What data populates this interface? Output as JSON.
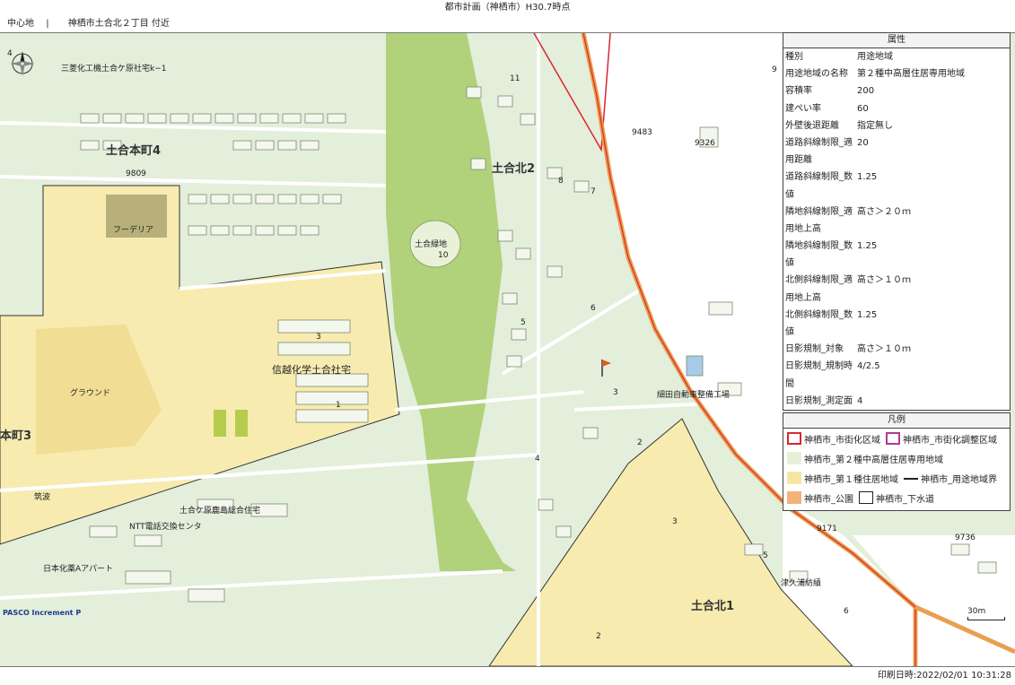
{
  "header": {
    "title": "都市計画（神栖市）H30.7時点",
    "location_label": "中心地",
    "location_value": "神栖市土合北２丁目 付近"
  },
  "map": {
    "labels": {
      "dogo_honmachi_4": "土合本町4",
      "dogo_kita_2": "土合北2",
      "dogo_kita_1": "土合北1",
      "honmachi_3": "本町3",
      "mitsubishi": "三菱化工機土合ケ原社宅k−1",
      "fuderia": "フーデリア",
      "ground": "グラウンド",
      "shinetsu": "信越化学土合社宅",
      "ryokuchi": "土合緑地",
      "ryokuchi_num": "10",
      "tsukuba": "筑波",
      "kashima": "土合ケ原鹿島総合住宅",
      "ntt": "NTT電話交換センタ",
      "nihonkayaku": "日本化薬Aアパート",
      "hosoda": "細田自動車整備工場",
      "tsukura": "津久浦紡績",
      "num_9809": "9809",
      "num_9326": "9326",
      "num_9483": "9483",
      "num_9171": "9171",
      "num_9736": "9736",
      "block_3a": "3",
      "block_1a": "1",
      "block_11": "11",
      "block_8": "8",
      "block_7": "7",
      "block_5": "5",
      "block_6": "6",
      "block_3b": "3",
      "block_4": "4",
      "block_2a": "2",
      "block_3c": "3",
      "block_2b": "2",
      "block_5b": "5",
      "block_6b": "6",
      "block_9a": "9",
      "block_4b": "4"
    },
    "pasco": "PASCO  Increment P",
    "scale": "30m"
  },
  "attributes": {
    "heading": "属性",
    "rows": [
      {
        "key": "種別",
        "value": "用途地域"
      },
      {
        "key": "用途地域の名称",
        "value": "第２種中高層住居専用地域"
      },
      {
        "key": "容積率",
        "value": "200"
      },
      {
        "key": "建ぺい率",
        "value": "60"
      },
      {
        "key": "外壁後退距離",
        "value": "指定無し"
      },
      {
        "key": "道路斜線制限_適",
        "value": "20"
      },
      {
        "key": "用距離",
        "value": ""
      },
      {
        "key": "道路斜線制限_数",
        "value": "1.25"
      },
      {
        "key": "値",
        "value": ""
      },
      {
        "key": "隣地斜線制限_適",
        "value": "高さ＞２０ｍ"
      },
      {
        "key": "用地上高",
        "value": ""
      },
      {
        "key": "隣地斜線制限_数",
        "value": "1.25"
      },
      {
        "key": "値",
        "value": ""
      },
      {
        "key": "北側斜線制限_適",
        "value": "高さ＞１０ｍ"
      },
      {
        "key": "用地上高",
        "value": ""
      },
      {
        "key": "北側斜線制限_数",
        "value": "1.25"
      },
      {
        "key": "値",
        "value": ""
      },
      {
        "key": "日影規制_対象",
        "value": "高さ＞１０ｍ"
      },
      {
        "key": "日影規制_規制時",
        "value": "4/2.5"
      },
      {
        "key": "間",
        "value": ""
      },
      {
        "key": "日影規制_測定面",
        "value": "4"
      }
    ]
  },
  "legend": {
    "heading": "凡例",
    "items": [
      {
        "label": "神栖市_市街化区域",
        "color": "#d9272e"
      },
      {
        "label": "神栖市_市街化調整区域",
        "color": "#b03a8c"
      },
      {
        "label": "神栖市_第２種中高層住居専用地域",
        "color": "#e6f0d8"
      },
      {
        "label": "神栖市_第１種住居地域",
        "color": "#f6e6a6"
      },
      {
        "label": "神栖市_用途地域界",
        "color": "#222222"
      },
      {
        "label": "神栖市_公園",
        "color": "#f2b27a"
      },
      {
        "label": "神栖市_下水道",
        "color": "#ffffff"
      }
    ]
  },
  "footer": {
    "print_date": "印刷日時:2022/02/01 10:31:28"
  },
  "colors": {
    "zone2_residential": "#e3eedb",
    "zone1_residential": "#f7ebb0",
    "park_green": "#a8cb6a",
    "boundary_red": "#d9272e",
    "boundary_orange": "#e8a050"
  }
}
